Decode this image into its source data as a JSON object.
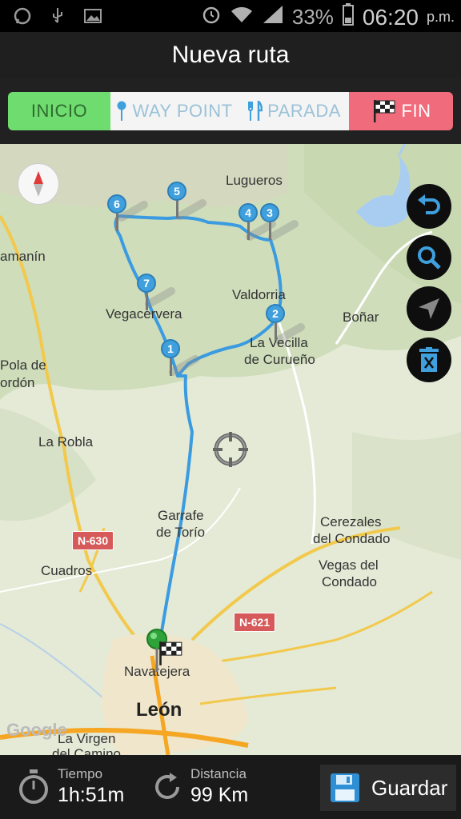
{
  "status_bar": {
    "battery": "33%",
    "time": "06:20",
    "ampm": "p.m.",
    "icons": [
      "whatsapp-icon",
      "usb-icon",
      "image-icon",
      "alarm-icon",
      "wifi-icon",
      "signal-icon",
      "battery-icon"
    ]
  },
  "header": {
    "title": "Nueva ruta"
  },
  "toolbar": {
    "inicio_label": "INICIO",
    "waypoint_label": "WAY POINT",
    "parada_label": "PARADA",
    "fin_label": "FIN",
    "colors": {
      "inicio": "#6fdc6f",
      "fin": "#f06b7c",
      "waypoint": "#9bc2d8"
    }
  },
  "map": {
    "labels": {
      "lugueros": "Lugueros",
      "valdorria": "Valdorria",
      "bonar": "Boñar",
      "vegacervera": "Vegacervera",
      "la_vecilla": "La Vecilla",
      "de_curueno": "de Curueño",
      "pola": "Pola de",
      "gordon": "ordón",
      "namanin": "amanín",
      "la_robla": "La Robla",
      "garrafe": "Garrafe",
      "de_torio": "de Torío",
      "cerezales": "Cerezales",
      "del_condado1": "del Condado",
      "vegas": "Vegas del",
      "condado": "Condado",
      "cuadros": "Cuadros",
      "navatejera": "Navatejera",
      "leon": "León",
      "virgen": "La Virgen",
      "camino": "del Camino",
      "google": "Google"
    },
    "roads": {
      "n630": "N-630",
      "n621": "N-621"
    },
    "waypoints": [
      "1",
      "2",
      "3",
      "4",
      "5",
      "6",
      "7"
    ],
    "route_color": "#3b9be0"
  },
  "controls": [
    "undo-icon",
    "zoom-icon",
    "locate-icon",
    "trash-icon"
  ],
  "footer": {
    "time_label": "Tiempo",
    "time_value": "1h:51m",
    "distance_label": "Distancia",
    "distance_value": "99 Km",
    "save_label": "Guardar"
  }
}
